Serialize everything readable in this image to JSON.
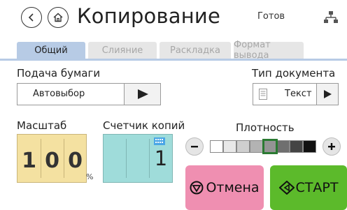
{
  "header": {
    "title": "Копирование",
    "status": "Готов",
    "icons": {
      "back": "back-arrow-icon",
      "home": "home-icon",
      "network": "network-icon"
    }
  },
  "tabs": [
    {
      "label": "Общий",
      "active": true
    },
    {
      "label": "Слияние",
      "active": false
    },
    {
      "label": "Раскладка",
      "active": false
    },
    {
      "label": "Формат вывода",
      "active": false
    }
  ],
  "paper_feed": {
    "label": "Подача бумаги",
    "value": "Автовыбор"
  },
  "doc_type": {
    "label": "Тип документа",
    "value": "Текст"
  },
  "scale": {
    "label": "Масштаб",
    "digits": [
      "1",
      "0",
      "0"
    ],
    "unit": "%"
  },
  "copies": {
    "label": "Счетчик копий",
    "value": "1"
  },
  "density": {
    "label": "Плотность",
    "level": 4,
    "levels": [
      "#ffffff",
      "#e8e8e8",
      "#cfcfcf",
      "#b3b3b3",
      "#949494",
      "#6f6f6f",
      "#444444",
      "#111111"
    ]
  },
  "actions": {
    "cancel": "Отмена",
    "start": "СТАРТ"
  },
  "colors": {
    "tab_active": "#b7cbe5",
    "scale": "#f4e1a1",
    "copies": "#9fdcda",
    "cancel": "#ef8fb1",
    "start": "#5cba2b"
  }
}
